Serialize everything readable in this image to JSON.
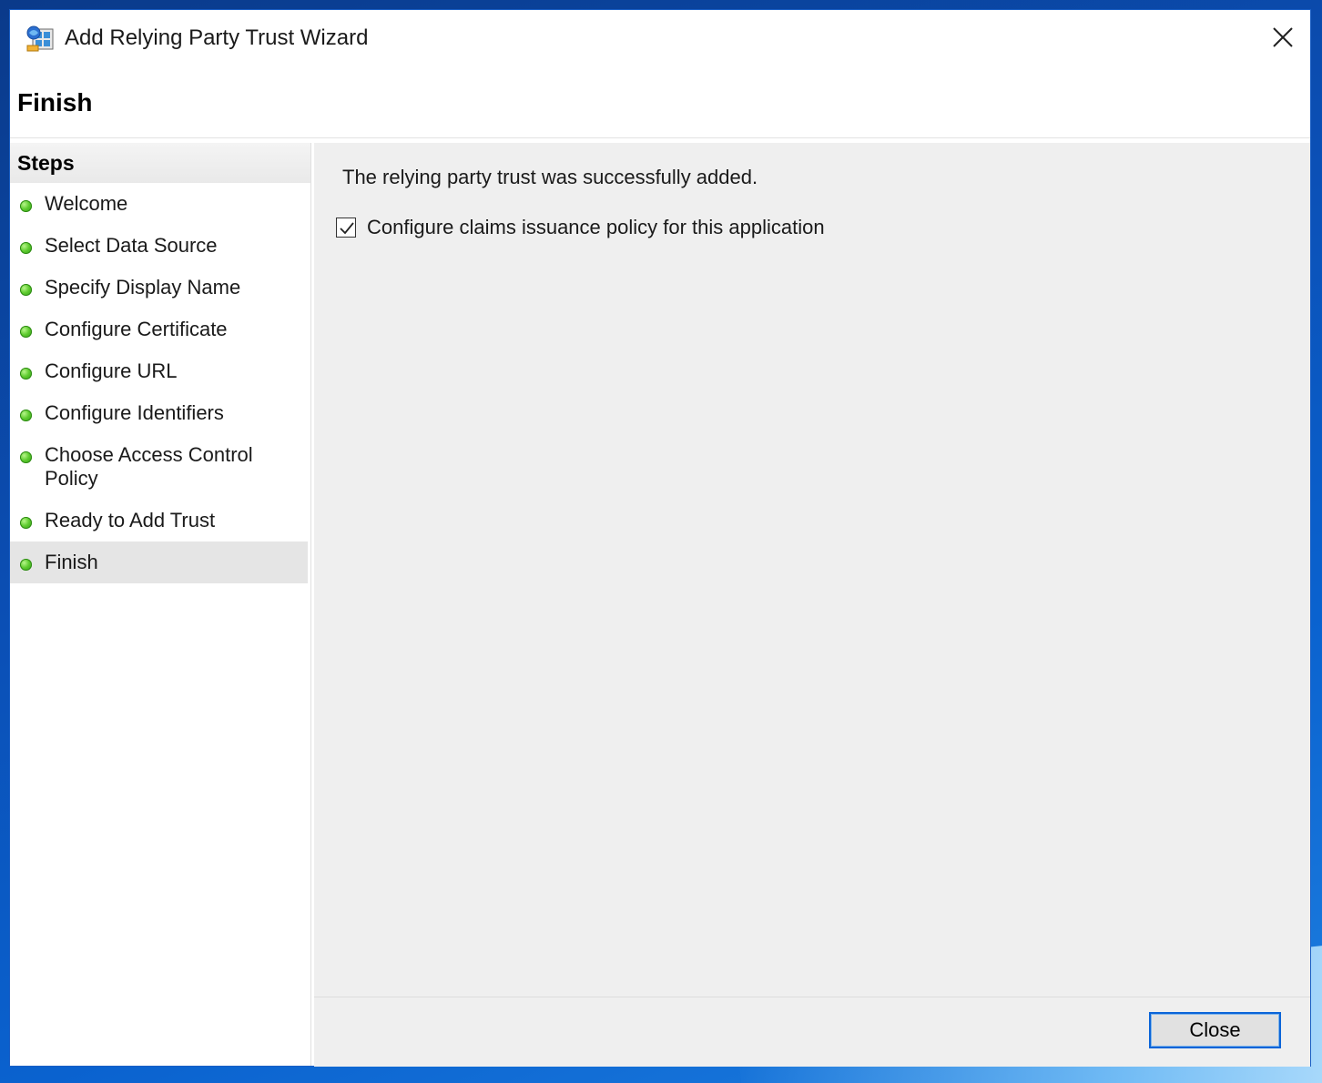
{
  "window": {
    "title": "Add Relying Party Trust Wizard"
  },
  "page": {
    "heading": "Finish"
  },
  "steps": {
    "header": "Steps",
    "items": [
      {
        "label": "Welcome"
      },
      {
        "label": "Select Data Source"
      },
      {
        "label": "Specify Display Name"
      },
      {
        "label": "Configure Certificate"
      },
      {
        "label": "Configure URL"
      },
      {
        "label": "Configure Identifiers"
      },
      {
        "label": "Choose Access Control Policy"
      },
      {
        "label": "Ready to Add Trust"
      },
      {
        "label": "Finish",
        "active": true
      }
    ]
  },
  "content": {
    "message": "The relying party trust was successfully added.",
    "checkbox_label": "Configure claims issuance policy for this application",
    "checkbox_checked": true
  },
  "footer": {
    "close_label": "Close"
  },
  "icons": {
    "app": "adfs-wizard-icon",
    "close": "close-icon",
    "step_status": "green-dot-icon",
    "check": "checkmark-icon"
  },
  "colors": {
    "accent": "#0a64d8",
    "step_dot": "#4cbb25",
    "desktop": "#0b4fb5"
  }
}
